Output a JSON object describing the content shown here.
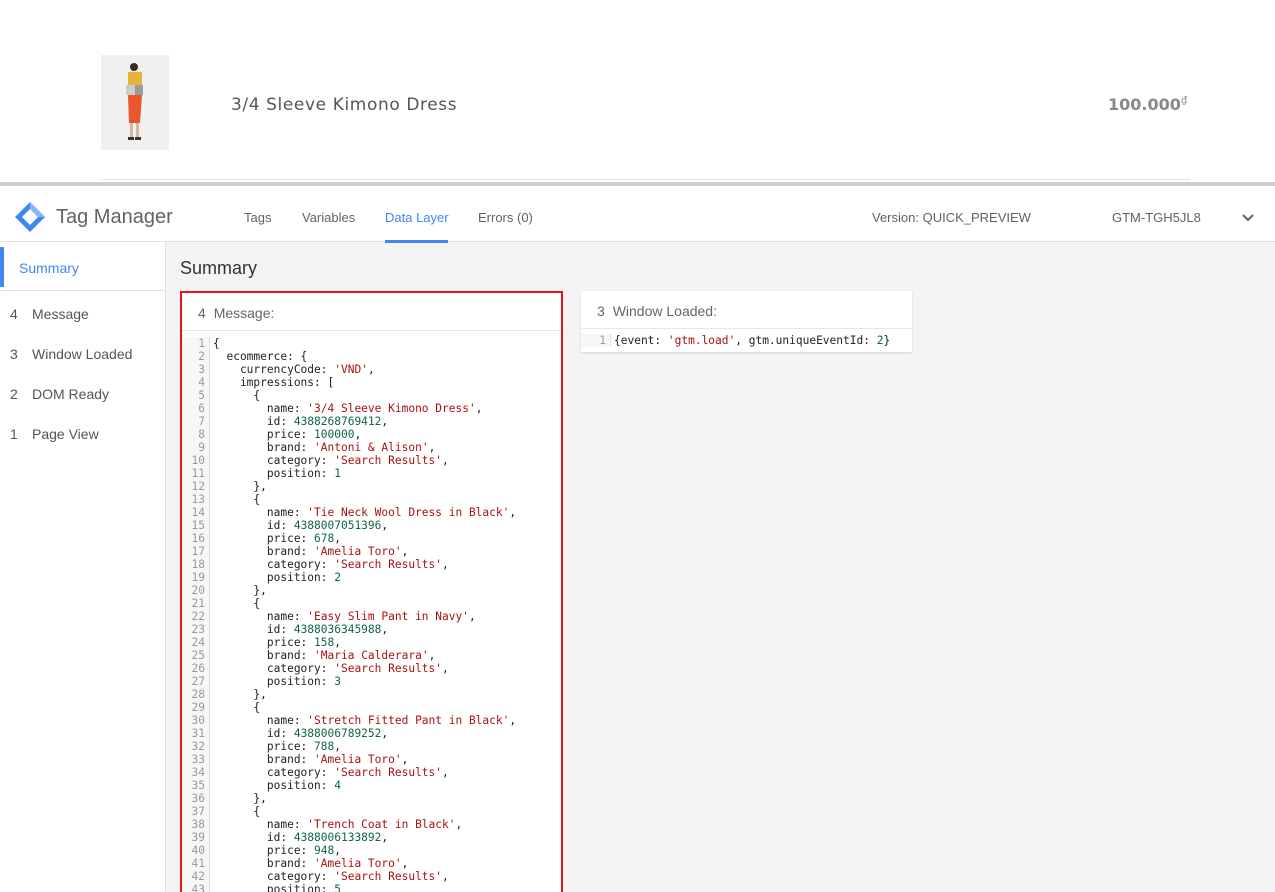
{
  "store": {
    "product_name": "3/4 Sleeve Kimono Dress",
    "price": "100.000",
    "currency_symbol": "₫"
  },
  "gtm": {
    "logo_text": "Tag Manager",
    "tabs": [
      {
        "label": "Tags",
        "active": false
      },
      {
        "label": "Variables",
        "active": false
      },
      {
        "label": "Data Layer",
        "active": true
      },
      {
        "label": "Errors (0)",
        "active": false
      }
    ],
    "version_label": "Version: QUICK_PREVIEW",
    "container_id": "GTM-TGH5JL8",
    "accent_color": "#4285f4",
    "highlight_color": "#e8141b"
  },
  "sidebar": {
    "summary_label": "Summary",
    "items": [
      {
        "num": "4",
        "label": "Message"
      },
      {
        "num": "3",
        "label": "Window Loaded"
      },
      {
        "num": "2",
        "label": "DOM Ready"
      },
      {
        "num": "1",
        "label": "Page View"
      }
    ]
  },
  "main": {
    "title": "Summary",
    "message_card": {
      "num": "4",
      "title": "Message:",
      "lines": [
        [
          [
            "t",
            "{"
          ]
        ],
        [
          [
            "t",
            "  ecommerce: {"
          ]
        ],
        [
          [
            "t",
            "    currencyCode: "
          ],
          [
            "s",
            "'VND'"
          ],
          [
            "t",
            ","
          ]
        ],
        [
          [
            "t",
            "    impressions: ["
          ]
        ],
        [
          [
            "t",
            "      {"
          ]
        ],
        [
          [
            "t",
            "        name: "
          ],
          [
            "s",
            "'3/4 Sleeve Kimono Dress'"
          ],
          [
            "t",
            ","
          ]
        ],
        [
          [
            "t",
            "        id: "
          ],
          [
            "n",
            "4388268769412"
          ],
          [
            "t",
            ","
          ]
        ],
        [
          [
            "t",
            "        price: "
          ],
          [
            "n",
            "100000"
          ],
          [
            "t",
            ","
          ]
        ],
        [
          [
            "t",
            "        brand: "
          ],
          [
            "s",
            "'Antoni & Alison'"
          ],
          [
            "t",
            ","
          ]
        ],
        [
          [
            "t",
            "        category: "
          ],
          [
            "s",
            "'Search Results'"
          ],
          [
            "t",
            ","
          ]
        ],
        [
          [
            "t",
            "        position: "
          ],
          [
            "n",
            "1"
          ]
        ],
        [
          [
            "t",
            "      },"
          ]
        ],
        [
          [
            "t",
            "      {"
          ]
        ],
        [
          [
            "t",
            "        name: "
          ],
          [
            "s",
            "'Tie Neck Wool Dress in Black'"
          ],
          [
            "t",
            ","
          ]
        ],
        [
          [
            "t",
            "        id: "
          ],
          [
            "n",
            "4388007051396"
          ],
          [
            "t",
            ","
          ]
        ],
        [
          [
            "t",
            "        price: "
          ],
          [
            "n",
            "678"
          ],
          [
            "t",
            ","
          ]
        ],
        [
          [
            "t",
            "        brand: "
          ],
          [
            "s",
            "'Amelia Toro'"
          ],
          [
            "t",
            ","
          ]
        ],
        [
          [
            "t",
            "        category: "
          ],
          [
            "s",
            "'Search Results'"
          ],
          [
            "t",
            ","
          ]
        ],
        [
          [
            "t",
            "        position: "
          ],
          [
            "n",
            "2"
          ]
        ],
        [
          [
            "t",
            "      },"
          ]
        ],
        [
          [
            "t",
            "      {"
          ]
        ],
        [
          [
            "t",
            "        name: "
          ],
          [
            "s",
            "'Easy Slim Pant in Navy'"
          ],
          [
            "t",
            ","
          ]
        ],
        [
          [
            "t",
            "        id: "
          ],
          [
            "n",
            "4388036345988"
          ],
          [
            "t",
            ","
          ]
        ],
        [
          [
            "t",
            "        price: "
          ],
          [
            "n",
            "158"
          ],
          [
            "t",
            ","
          ]
        ],
        [
          [
            "t",
            "        brand: "
          ],
          [
            "s",
            "'Maria Calderara'"
          ],
          [
            "t",
            ","
          ]
        ],
        [
          [
            "t",
            "        category: "
          ],
          [
            "s",
            "'Search Results'"
          ],
          [
            "t",
            ","
          ]
        ],
        [
          [
            "t",
            "        position: "
          ],
          [
            "n",
            "3"
          ]
        ],
        [
          [
            "t",
            "      },"
          ]
        ],
        [
          [
            "t",
            "      {"
          ]
        ],
        [
          [
            "t",
            "        name: "
          ],
          [
            "s",
            "'Stretch Fitted Pant in Black'"
          ],
          [
            "t",
            ","
          ]
        ],
        [
          [
            "t",
            "        id: "
          ],
          [
            "n",
            "4388006789252"
          ],
          [
            "t",
            ","
          ]
        ],
        [
          [
            "t",
            "        price: "
          ],
          [
            "n",
            "788"
          ],
          [
            "t",
            ","
          ]
        ],
        [
          [
            "t",
            "        brand: "
          ],
          [
            "s",
            "'Amelia Toro'"
          ],
          [
            "t",
            ","
          ]
        ],
        [
          [
            "t",
            "        category: "
          ],
          [
            "s",
            "'Search Results'"
          ],
          [
            "t",
            ","
          ]
        ],
        [
          [
            "t",
            "        position: "
          ],
          [
            "n",
            "4"
          ]
        ],
        [
          [
            "t",
            "      },"
          ]
        ],
        [
          [
            "t",
            "      {"
          ]
        ],
        [
          [
            "t",
            "        name: "
          ],
          [
            "s",
            "'Trench Coat in Black'"
          ],
          [
            "t",
            ","
          ]
        ],
        [
          [
            "t",
            "        id: "
          ],
          [
            "n",
            "4388006133892"
          ],
          [
            "t",
            ","
          ]
        ],
        [
          [
            "t",
            "        price: "
          ],
          [
            "n",
            "948"
          ],
          [
            "t",
            ","
          ]
        ],
        [
          [
            "t",
            "        brand: "
          ],
          [
            "s",
            "'Amelia Toro'"
          ],
          [
            "t",
            ","
          ]
        ],
        [
          [
            "t",
            "        category: "
          ],
          [
            "s",
            "'Search Results'"
          ],
          [
            "t",
            ","
          ]
        ],
        [
          [
            "t",
            "        position: "
          ],
          [
            "n",
            "5"
          ]
        ]
      ]
    },
    "window_loaded_card": {
      "num": "3",
      "title": "Window Loaded:",
      "lines": [
        [
          [
            "t",
            "{event: "
          ],
          [
            "s",
            "'gtm.load'"
          ],
          [
            "t",
            ", gtm.uniqueEventId: "
          ],
          [
            "n",
            "2"
          ],
          [
            "t",
            "}"
          ]
        ]
      ]
    }
  }
}
